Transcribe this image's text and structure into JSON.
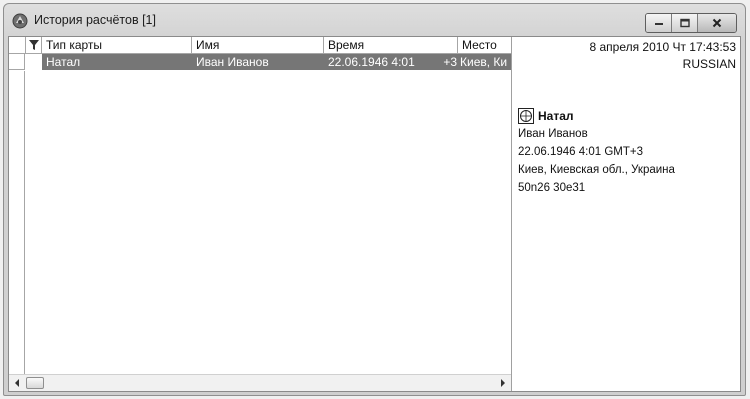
{
  "window": {
    "title": "История расчётов [1]"
  },
  "table": {
    "columns": [
      {
        "label": "Тип карты"
      },
      {
        "label": "Имя"
      },
      {
        "label": "Время"
      },
      {
        "label": "Место"
      }
    ],
    "rows": [
      {
        "type": "Натал",
        "name": "Иван Иванов",
        "time": "22.06.1946  4:01",
        "tz": "+3",
        "place": "Киев, Ки"
      }
    ]
  },
  "details": {
    "date": "8 апреля 2010 Чт 17:43:53",
    "language": "RUSSIAN",
    "chart_type": "Натал",
    "name": "Иван Иванов",
    "datetime": "22.06.1946  4:01  GMT+3",
    "place": "Киев, Киевская обл., Украина",
    "coords": "50n26 30e31"
  },
  "colors": {
    "selection": "#767676",
    "chrome": "#d4d4d4"
  },
  "icons": {
    "app": "astrology-app-icon",
    "filter": "filter-icon",
    "chart": "natal-chart-icon"
  }
}
